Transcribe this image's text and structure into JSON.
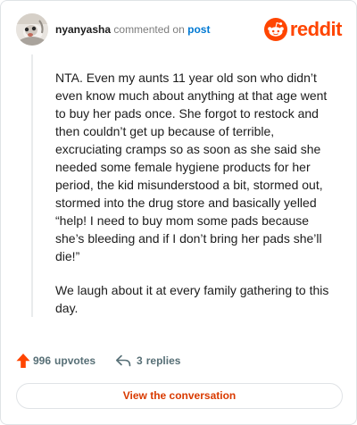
{
  "comment": {
    "author": "nyanyasha",
    "action_text": "commented on",
    "target_link": "post",
    "avatar_icon": "user-avatar",
    "paragraphs": [
      "NTA. Even my aunts 11 year old son who didn’t even know much about anything at that age went to buy her pads once. She forgot to restock and then couldn’t get up because of terrible, excruciating cramps so as soon as she said she needed some female hygiene products for her period, the kid misunderstood a bit, stormed out, stormed into the drug store and basically yelled “help! I need to buy mom some pads because she’s bleeding and if I don’t bring her pads she’ll die!”",
      "We laugh about it at every family gathering to this day."
    ]
  },
  "brand": {
    "name": "reddit",
    "icon": "reddit-snoo-icon",
    "color": "#ff4500"
  },
  "footer": {
    "upvotes_count": "996",
    "upvotes_label": "upvotes",
    "upvote_icon": "upvote-arrow-icon",
    "upvote_color": "#ff4500",
    "replies_count": "3",
    "replies_label": "replies",
    "reply_icon": "reply-arrow-icon"
  },
  "actions": {
    "view_conversation_label": "View the conversation",
    "accent_color": "#d93a00"
  }
}
